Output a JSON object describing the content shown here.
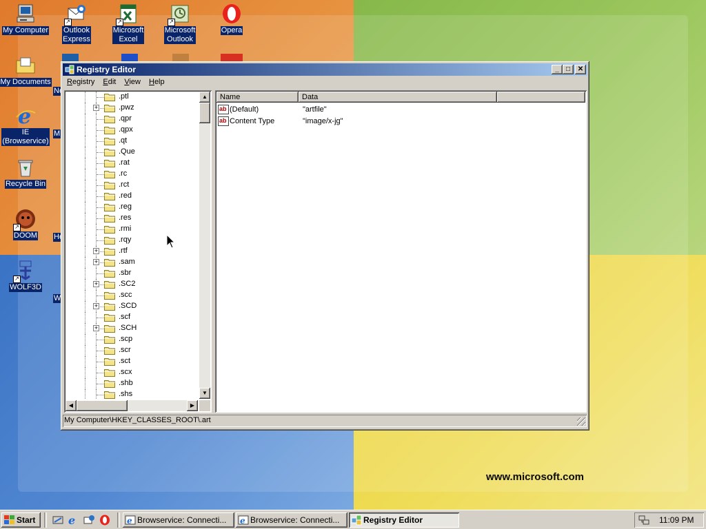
{
  "desktop": {
    "wallpaper_url_text": "www.microsoft.com",
    "icons": [
      {
        "name": "my-computer",
        "label_lines": [
          "My Computer"
        ]
      },
      {
        "name": "outlook-express",
        "label_lines": [
          "Outlook",
          "Express"
        ]
      },
      {
        "name": "microsoft-excel",
        "label_lines": [
          "Microsoft",
          "Excel"
        ]
      },
      {
        "name": "microsoft-outlook",
        "label_lines": [
          "Microsoft",
          "Outlook"
        ]
      },
      {
        "name": "opera",
        "label_lines": [
          "Opera"
        ]
      },
      {
        "name": "my-documents",
        "label_lines": [
          "My Documents"
        ]
      },
      {
        "name": "ie-browservice",
        "label_lines": [
          "IE",
          "(Browservice)"
        ]
      },
      {
        "name": "recycle-bin",
        "label_lines": [
          "Recycle Bin"
        ]
      },
      {
        "name": "doom",
        "label_lines": [
          "DOOM"
        ]
      },
      {
        "name": "wolf3d",
        "label_lines": [
          "WOLF3D"
        ]
      }
    ],
    "peek_labels": [
      "Ne",
      "M",
      "He",
      "W"
    ]
  },
  "window": {
    "title": "Registry Editor",
    "menu": [
      {
        "label": "Registry",
        "accel": "R",
        "rest": "egistry"
      },
      {
        "label": "Edit",
        "accel": "E",
        "rest": "dit"
      },
      {
        "label": "View",
        "accel": "V",
        "rest": "iew"
      },
      {
        "label": "Help",
        "accel": "H",
        "rest": "elp"
      }
    ],
    "tree_items": [
      {
        "label": ".ptl",
        "expandable": false
      },
      {
        "label": ".pwz",
        "expandable": true
      },
      {
        "label": ".qpr",
        "expandable": false
      },
      {
        "label": ".qpx",
        "expandable": false
      },
      {
        "label": ".qt",
        "expandable": false
      },
      {
        "label": ".Que",
        "expandable": false
      },
      {
        "label": ".rat",
        "expandable": false
      },
      {
        "label": ".rc",
        "expandable": false
      },
      {
        "label": ".rct",
        "expandable": false
      },
      {
        "label": ".red",
        "expandable": false
      },
      {
        "label": ".reg",
        "expandable": false
      },
      {
        "label": ".res",
        "expandable": false
      },
      {
        "label": ".rmi",
        "expandable": false
      },
      {
        "label": ".rqy",
        "expandable": false
      },
      {
        "label": ".rtf",
        "expandable": true
      },
      {
        "label": ".sam",
        "expandable": true
      },
      {
        "label": ".sbr",
        "expandable": false
      },
      {
        "label": ".SC2",
        "expandable": true
      },
      {
        "label": ".scc",
        "expandable": false
      },
      {
        "label": ".SCD",
        "expandable": true
      },
      {
        "label": ".scf",
        "expandable": false
      },
      {
        "label": ".SCH",
        "expandable": true
      },
      {
        "label": ".scp",
        "expandable": false
      },
      {
        "label": ".scr",
        "expandable": false
      },
      {
        "label": ".sct",
        "expandable": false
      },
      {
        "label": ".scx",
        "expandable": false
      },
      {
        "label": ".shb",
        "expandable": false
      },
      {
        "label": ".shs",
        "expandable": false
      }
    ],
    "list": {
      "columns": [
        "Name",
        "Data"
      ],
      "rows": [
        {
          "name": "(Default)",
          "data": "\"artfile\""
        },
        {
          "name": "Content Type",
          "data": "\"image/x-jg\""
        }
      ]
    },
    "status_path": "My Computer\\HKEY_CLASSES_ROOT\\.art"
  },
  "taskbar": {
    "start_label": "Start",
    "tasks": [
      {
        "label": "Browservice: Connecti...",
        "active": false
      },
      {
        "label": "Browservice: Connecti...",
        "active": false
      },
      {
        "label": "Registry Editor",
        "active": true
      }
    ],
    "clock": "11:09 PM"
  },
  "colors": {
    "title_active": "#0a246a",
    "selection": "#0a246a",
    "face": "#d4d0c8"
  }
}
